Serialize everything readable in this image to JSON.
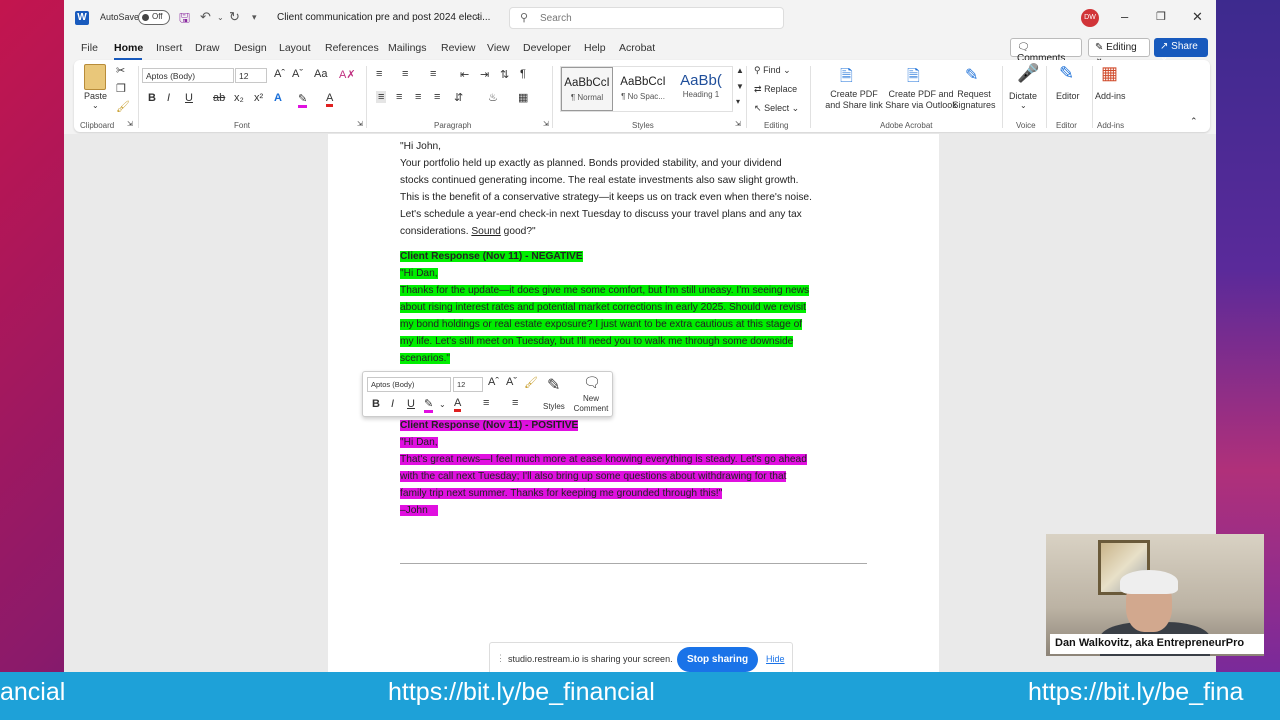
{
  "titlebar": {
    "autosave_label": "AutoSave",
    "autosave_state": "Off",
    "document_title": "Client communication pre and post 2024 electi...",
    "search_placeholder": "Search",
    "user_initials": "DW"
  },
  "menu": {
    "tabs": [
      "File",
      "Home",
      "Insert",
      "Draw",
      "Design",
      "Layout",
      "References",
      "Mailings",
      "Review",
      "View",
      "Developer",
      "Help",
      "Acrobat"
    ],
    "active_tab": "Home",
    "comments_label": "Comments",
    "editing_label": "Editing",
    "share_label": "Share"
  },
  "ribbon": {
    "clipboard": {
      "paste_label": "Paste",
      "group_label": "Clipboard"
    },
    "font": {
      "font_name": "Aptos (Body)",
      "font_size": "12",
      "group_label": "Font"
    },
    "paragraph": {
      "group_label": "Paragraph"
    },
    "styles": {
      "items": [
        {
          "preview": "AaBbCcI",
          "name": "¶ Normal"
        },
        {
          "preview": "AaBbCcI",
          "name": "¶ No Spac..."
        },
        {
          "preview": "AaBb(",
          "name": "Heading 1"
        }
      ],
      "group_label": "Styles"
    },
    "editing": {
      "find_label": "Find",
      "replace_label": "Replace",
      "select_label": "Select",
      "group_label": "Editing"
    },
    "acrobat": {
      "btn1_line1": "Create PDF",
      "btn1_line2": "and Share link",
      "btn2_line1": "Create PDF and",
      "btn2_line2": "Share via Outlook",
      "btn3_line1": "Request",
      "btn3_line2": "Signatures",
      "group_label": "Adobe Acrobat"
    },
    "voice": {
      "dictate_label": "Dictate",
      "group_label": "Voice"
    },
    "editor": {
      "editor_label": "Editor",
      "group_label": "Editor"
    },
    "addins": {
      "addins_label": "Add-ins",
      "group_label": "Add-ins"
    }
  },
  "document": {
    "para1_greeting": "\"Hi John,",
    "para1_lines": [
      "Your portfolio held up exactly as planned. Bonds provided stability, and your dividend",
      "stocks continued generating income. The real estate investments also saw slight growth.",
      "This is the benefit of a conservative strategy—it keeps us on track even when there's noise.",
      "Let's schedule a year-end check-in next Tuesday to discuss your travel plans and any tax"
    ],
    "para1_last_prefix": "considerations. ",
    "para1_last_underlined": "Sound",
    "para1_last_suffix": " good?\"",
    "negative_heading": "Client Response (Nov 11) - NEGATIVE",
    "negative_greeting": "\"Hi Dan,",
    "negative_lines": [
      "Thanks for the update—it does give me some comfort, but I'm still uneasy. I'm seeing news",
      "about rising interest rates and potential market corrections in early 2025. Should we revisit",
      "my bond holdings or real estate exposure? I just want to be extra cautious at this stage of",
      "my life. Let's still meet on Tuesday, but I'll need you to walk me through some downside",
      "scenarios.\""
    ],
    "positive_heading": "Client Response (Nov 11) - POSITIVE",
    "positive_greeting": "\"Hi Dan,",
    "positive_lines": [
      "That's great news—I feel much more at ease knowing everything is steady. Let's go ahead",
      "with the call next Tuesday; I'll also bring up some questions about withdrawing for that",
      "family trip next summer. Thanks for keeping me grounded through this!\""
    ],
    "positive_signature": "–John"
  },
  "mini_toolbar": {
    "font_name": "Aptos (Body)",
    "font_size": "12",
    "styles_label": "Styles",
    "new_comment_line1": "New",
    "new_comment_line2": "Comment"
  },
  "share_bar": {
    "message": "studio.restream.io is sharing your screen.",
    "stop_label": "Stop sharing",
    "hide_label": "Hide"
  },
  "webcam": {
    "name_label": "Dan Walkovitz, aka EntrepreneurPro"
  },
  "ticker": {
    "text_partial_left": "ancial",
    "text_full": "https://bit.ly/be_financial",
    "text_partial_right": "https://bit.ly/be_fina"
  },
  "colors": {
    "word_blue": "#185abd",
    "highlight_green": "#00ee00",
    "highlight_magenta": "#e010e0",
    "ticker_blue": "#1ea1d8",
    "stop_blue": "#1a73e8"
  }
}
